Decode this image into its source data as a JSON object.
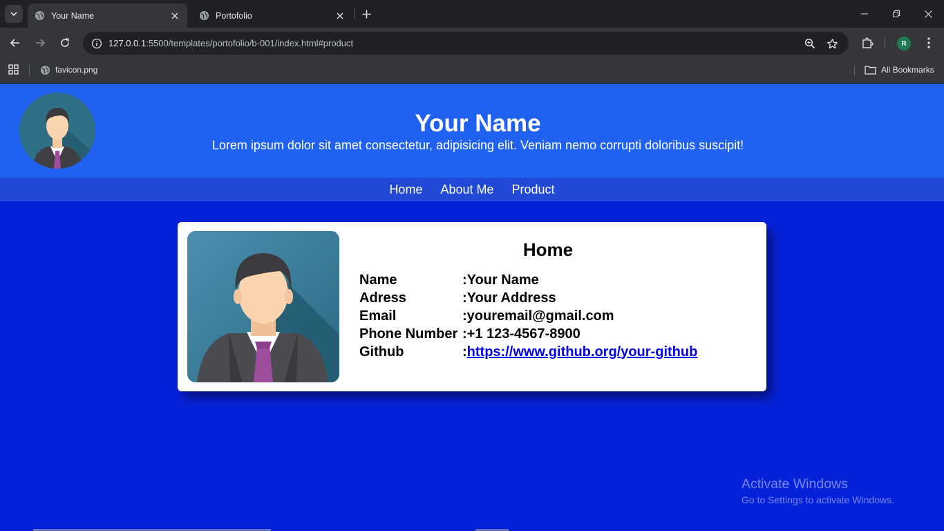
{
  "browser": {
    "tabs": [
      {
        "title": "Your Name",
        "active": true
      },
      {
        "title": "Portofolio",
        "active": false
      }
    ],
    "url_host": "127.0.0.1",
    "url_path": ":5500/templates/portofolio/b-001/index.html#product",
    "bookmark_item": "favicon.png",
    "all_bookmarks": "All Bookmarks",
    "profile_initial": "R"
  },
  "header": {
    "title": "Your Name",
    "tagline": "Lorem ipsum dolor sit amet consectetur, adipisicing elit. Veniam nemo corrupti doloribus suscipit!"
  },
  "nav": {
    "items": [
      "Home",
      "About Me",
      "Product"
    ]
  },
  "card": {
    "heading": "Home",
    "rows": [
      {
        "label": "Name",
        "value": ":Your Name"
      },
      {
        "label": "Adress",
        "value": ":Your Address"
      },
      {
        "label": "Email",
        "value": ":youremail@gmail.com"
      },
      {
        "label": "Phone Number",
        "value": ":+1 123-4567-8900"
      },
      {
        "label": "Github",
        "value_prefix": ":",
        "link": "https://www.github.org/your-github"
      }
    ]
  },
  "watermark": {
    "line1": "Activate Windows",
    "line2": "Go to Settings to activate Windows."
  },
  "colors": {
    "header_bg": "#2061f0",
    "nav_bg": "#2249d6",
    "page_bg": "#0622d8",
    "card_bg": "#ffffff",
    "link": "#0000ee"
  }
}
